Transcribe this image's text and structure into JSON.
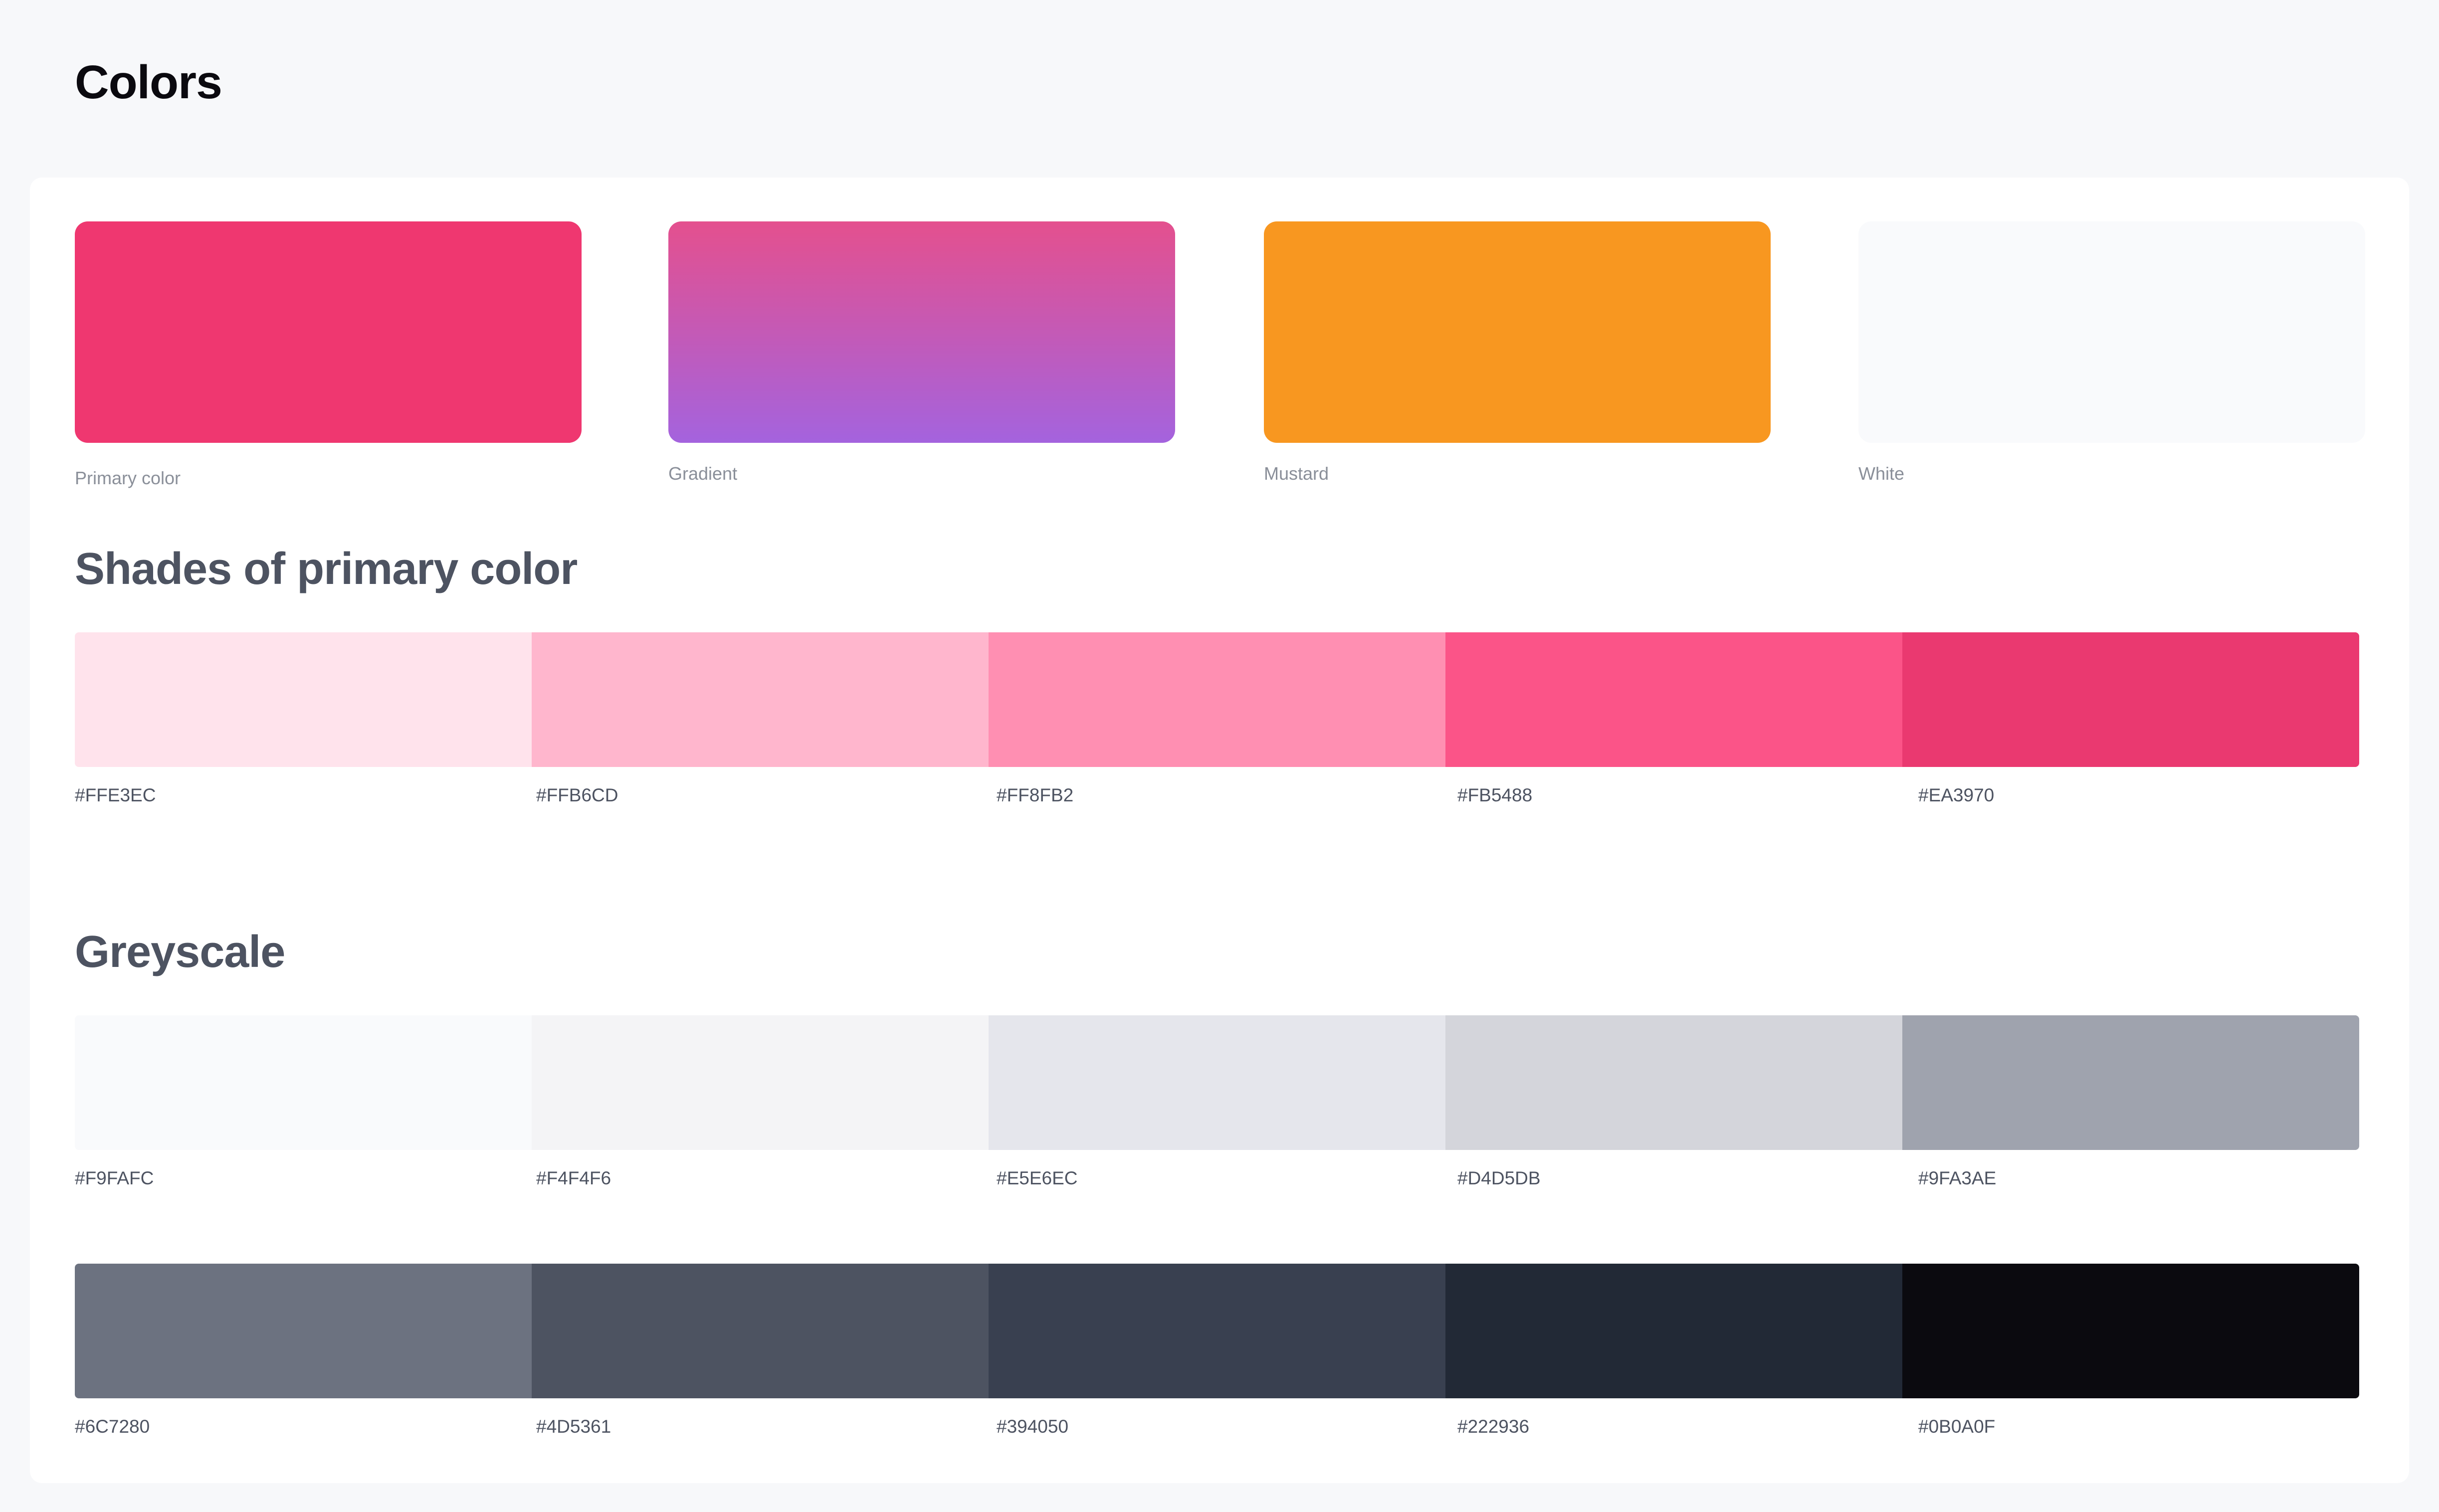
{
  "page": {
    "title": "Colors"
  },
  "main_colors": [
    {
      "label": "Primary color",
      "color": "#EF3770"
    },
    {
      "label": "Gradient",
      "color_top": "#E4508E",
      "color_bottom": "#A463DE"
    },
    {
      "label": "Mustard",
      "color": "#F89720"
    },
    {
      "label": "White",
      "color": "#F9FAFC"
    }
  ],
  "shades": {
    "title": "Shades of primary color",
    "items": [
      {
        "hex": "#FFE3EC"
      },
      {
        "hex": "#FFB6CD"
      },
      {
        "hex": "#FF8FB2"
      },
      {
        "hex": "#FB5488"
      },
      {
        "hex": "#EA3970"
      }
    ]
  },
  "greyscale": {
    "title": "Greyscale",
    "light": [
      {
        "hex": "#F9FAFC"
      },
      {
        "hex": "#F4F4F6"
      },
      {
        "hex": "#E5E6EC"
      },
      {
        "hex": "#D4D5DB"
      },
      {
        "hex": "#9FA3AE"
      }
    ],
    "dark": [
      {
        "hex": "#6C7280"
      },
      {
        "hex": "#4D5361"
      },
      {
        "hex": "#394050"
      },
      {
        "hex": "#222936"
      },
      {
        "hex": "#0B0A0F"
      }
    ]
  }
}
